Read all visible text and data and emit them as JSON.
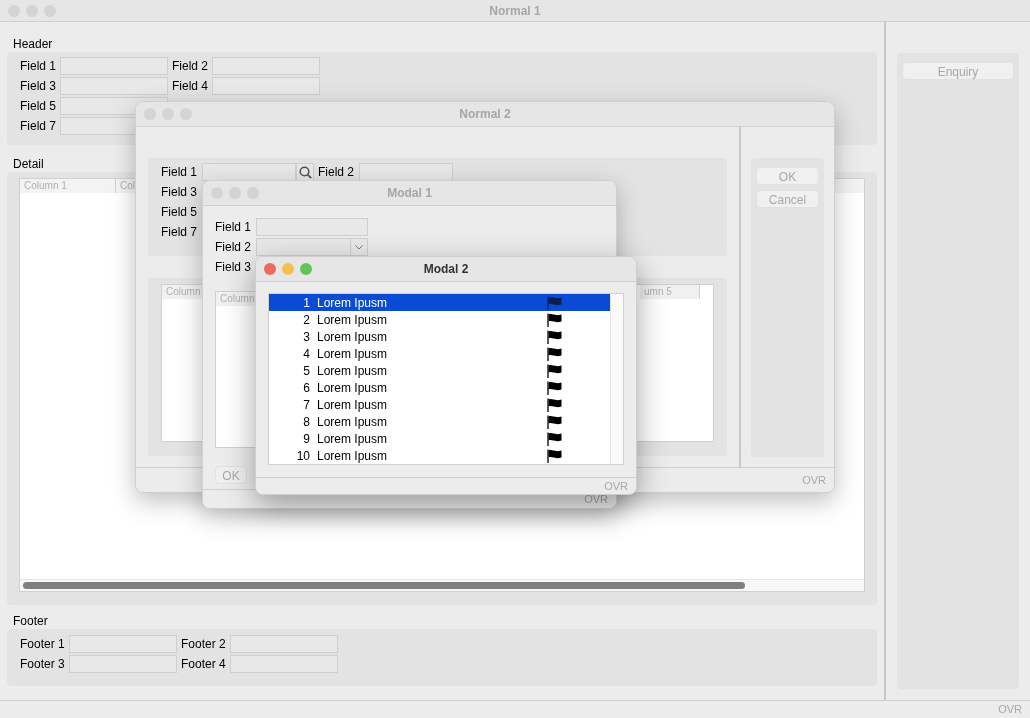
{
  "normal_1": {
    "title": "Normal 1",
    "active": false,
    "header": {
      "label": "Header",
      "field_lines": [
        [
          {
            "label": "Field 1",
            "kind": "text"
          },
          {
            "label": "Field 2",
            "kind": "text"
          }
        ],
        [
          {
            "label": "Field 3",
            "kind": "text"
          },
          {
            "label": "Field 4",
            "kind": "text"
          }
        ],
        [
          {
            "label": "Field 5",
            "kind": "text"
          }
        ],
        [
          {
            "label": "Field 7",
            "kind": "text"
          }
        ]
      ]
    },
    "detail": {
      "label": "Detail",
      "columns": [
        "Column 1",
        "Col"
      ]
    },
    "footer": {
      "label": "Footer",
      "field_lines": [
        [
          {
            "label": "Footer 1",
            "kind": "text"
          },
          {
            "label": "Footer 2",
            "kind": "text"
          }
        ],
        [
          {
            "label": "Footer 3",
            "kind": "text"
          },
          {
            "label": "Footer 4",
            "kind": "text"
          }
        ]
      ]
    },
    "side_buttons": [
      "Enquiry"
    ],
    "status": "OVR"
  },
  "normal_2": {
    "title": "Normal 2",
    "active": false,
    "field_lines": [
      [
        {
          "label": "Field 1",
          "kind": "lookup"
        },
        {
          "label": "Field 2",
          "kind": "text"
        }
      ],
      [
        {
          "label": "Field 3",
          "kind": "label"
        }
      ],
      [
        {
          "label": "Field 5",
          "kind": "label"
        }
      ],
      [
        {
          "label": "Field 7",
          "kind": "label"
        }
      ]
    ],
    "columns": [
      "Column",
      "umn 5"
    ],
    "buttons": [
      "OK",
      "Cancel"
    ],
    "status": "OVR"
  },
  "modal_1": {
    "title": "Modal 1",
    "active": false,
    "field_lines": [
      [
        {
          "label": "Field 1",
          "kind": "text"
        }
      ],
      [
        {
          "label": "Field 2",
          "kind": "combo"
        }
      ],
      [
        {
          "label": "Field 3",
          "kind": "label"
        }
      ]
    ],
    "columns": [
      "Column"
    ],
    "buttons": [
      "OK"
    ],
    "status": "OVR"
  },
  "modal_2": {
    "title": "Modal 2",
    "active": true,
    "items": [
      {
        "number": "1",
        "text": "Lorem Ipusm",
        "selected": true
      },
      {
        "number": "2",
        "text": "Lorem Ipusm",
        "selected": false
      },
      {
        "number": "3",
        "text": "Lorem Ipusm",
        "selected": false
      },
      {
        "number": "4",
        "text": "Lorem Ipusm",
        "selected": false
      },
      {
        "number": "5",
        "text": "Lorem Ipusm",
        "selected": false
      },
      {
        "number": "6",
        "text": "Lorem Ipusm",
        "selected": false
      },
      {
        "number": "7",
        "text": "Lorem Ipusm",
        "selected": false
      },
      {
        "number": "8",
        "text": "Lorem Ipusm",
        "selected": false
      },
      {
        "number": "9",
        "text": "Lorem Ipusm",
        "selected": false
      },
      {
        "number": "10",
        "text": "Lorem Ipusm",
        "selected": false
      }
    ],
    "status": "OVR"
  }
}
